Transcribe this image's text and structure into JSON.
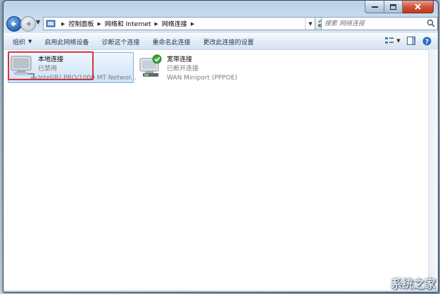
{
  "breadcrumbs": [
    "控制面板",
    "网络和 Internet",
    "网络连接"
  ],
  "search": {
    "placeholder": "搜索 网络连接"
  },
  "command_bar": {
    "organize": "组织",
    "enable_device": "启用此网络设备",
    "diagnose": "诊断这个连接",
    "rename": "重命名此连接",
    "change_settings": "更改此连接的设置"
  },
  "connections": [
    {
      "name": "本地连接",
      "status": "已禁用",
      "device": "Intel(R) PRO/1000 MT Networ...",
      "selected": true
    },
    {
      "name": "宽带连接",
      "status": "已断开连接",
      "device": "WAN Miniport (PPPOE)",
      "selected": false
    }
  ],
  "watermark": {
    "text": "系统之家"
  },
  "colors": {
    "accent": "#2f6fc0",
    "highlight_outline": "#d4343b",
    "selection": "#cfe3f8",
    "status_ok": "#3aa635"
  }
}
